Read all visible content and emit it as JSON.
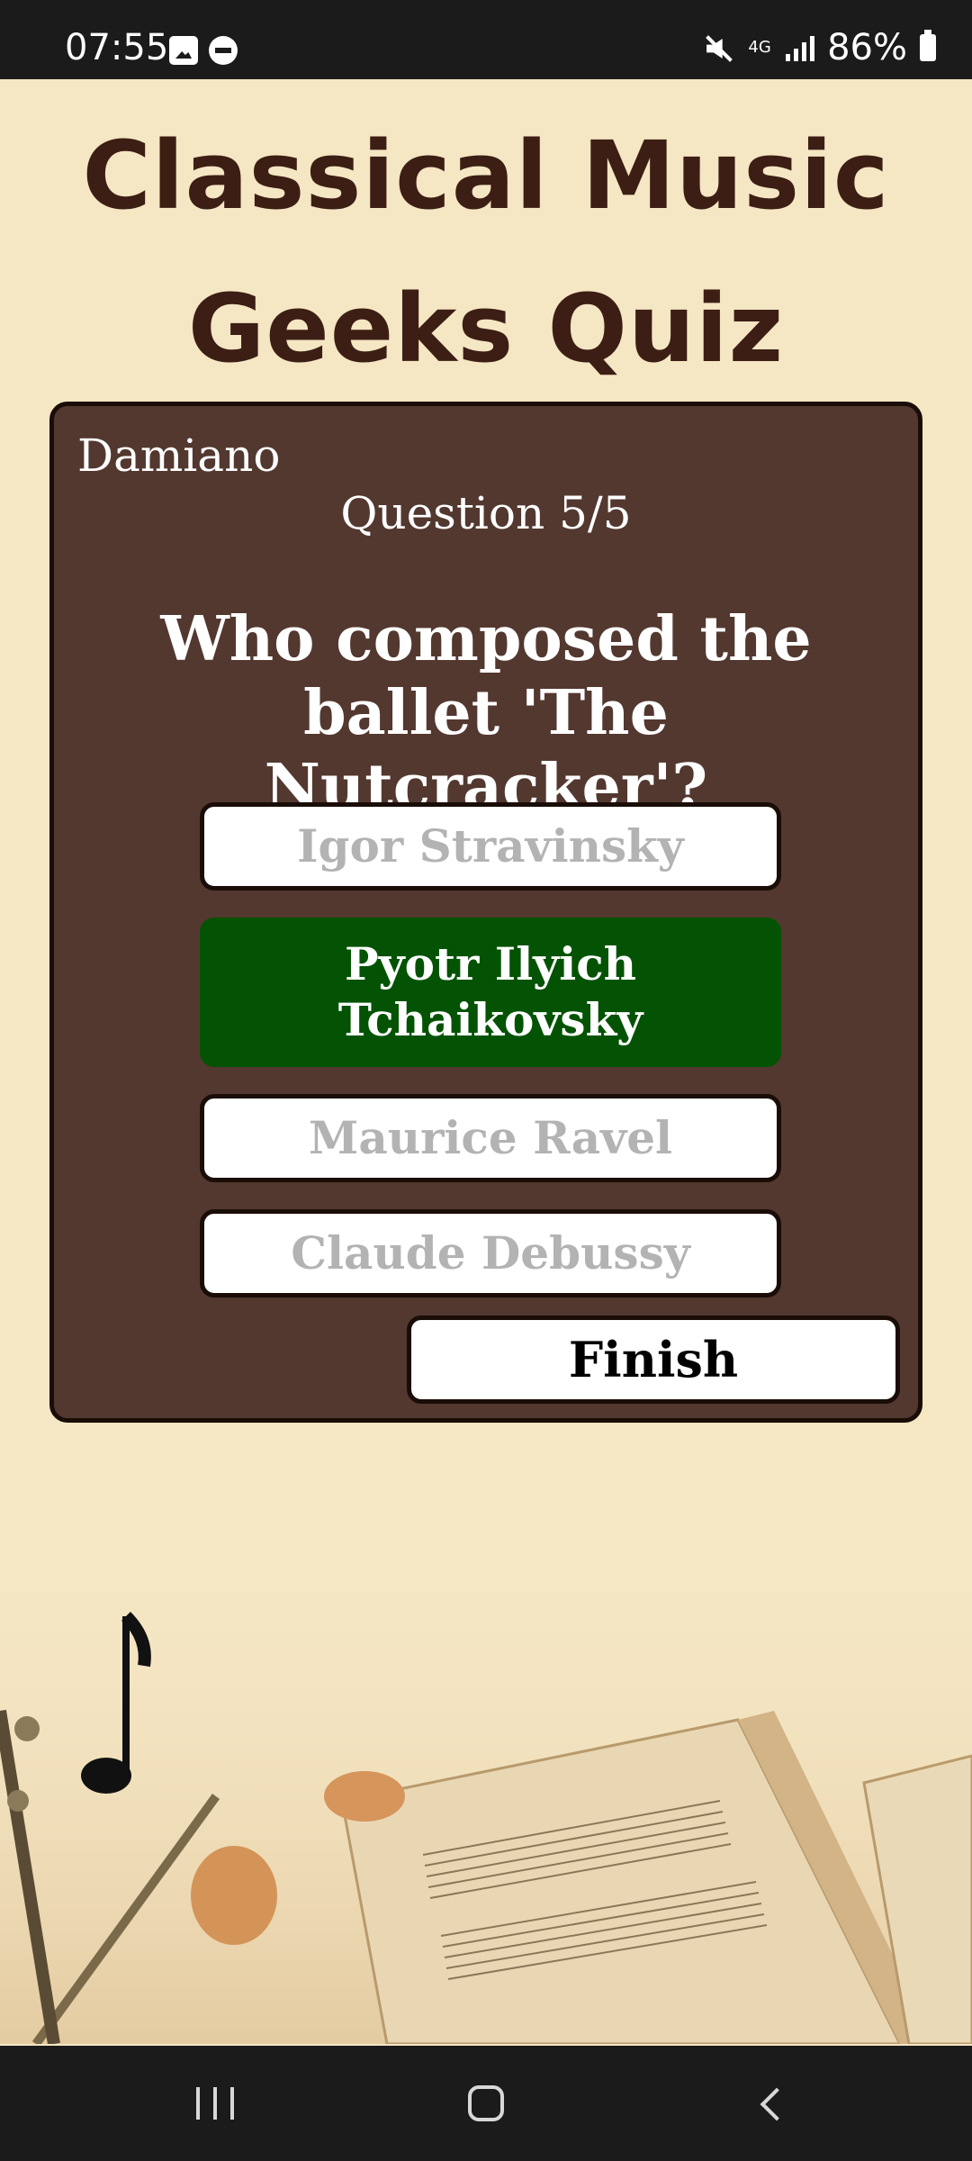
{
  "status_bar": {
    "time": "07:55",
    "network": "4G",
    "battery": "86%"
  },
  "app": {
    "title": "Classical Music Geeks Quiz"
  },
  "quiz": {
    "player": "Damiano",
    "question_counter": "Question 5/5",
    "question": "Who composed the ballet 'The Nutcracker'?",
    "answers": [
      {
        "label": "Igor Stravinsky",
        "state": "disabled"
      },
      {
        "label": "Pyotr Ilyich Tchaikovsky",
        "state": "correct"
      },
      {
        "label": "Maurice Ravel",
        "state": "disabled"
      },
      {
        "label": "Claude Debussy",
        "state": "disabled"
      }
    ],
    "finish_label": "Finish"
  },
  "colors": {
    "background": "#f5e6c4",
    "title": "#3c1e14",
    "card": "#533830",
    "correct": "#045304",
    "disabled_text": "#b3b3b3"
  },
  "icons": {
    "status_left": [
      "image-icon",
      "do-not-disturb-icon"
    ],
    "status_right": [
      "mute-icon",
      "network-4g-icon",
      "signal-icon",
      "battery-icon"
    ],
    "nav": [
      "recents-icon",
      "home-icon",
      "back-icon"
    ]
  }
}
